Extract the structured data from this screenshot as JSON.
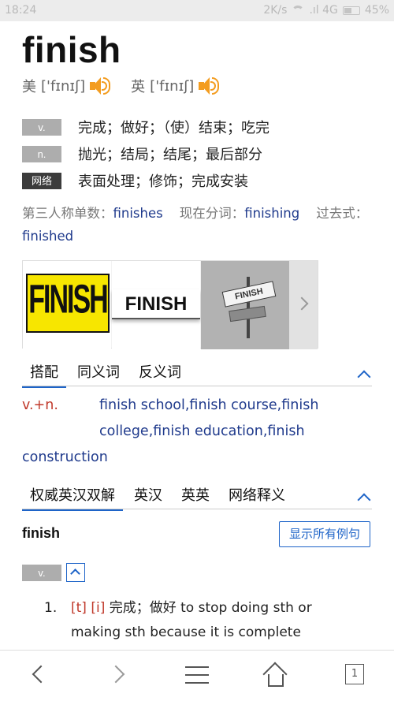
{
  "status_bar": {
    "time": "18:24",
    "network_speed": "2K/s",
    "signal": ".ıl 4G",
    "battery": "45%"
  },
  "word": "finish",
  "pronunciation": [
    {
      "label": "美",
      "ipa": "['fɪnɪʃ]"
    },
    {
      "label": "英",
      "ipa": "['fɪnɪʃ]"
    }
  ],
  "definitions": [
    {
      "pos": "v.",
      "text": "完成；做好；（使）结束；吃完"
    },
    {
      "pos": "n.",
      "text": "抛光；结局；结尾；最后部分"
    },
    {
      "pos": "网络",
      "text": "表面处理；修饰；完成安装"
    }
  ],
  "word_forms": [
    {
      "label": "第三人称单数：",
      "value": "finishes"
    },
    {
      "label": "现在分词：",
      "value": "finishing"
    },
    {
      "label": "过去式：",
      "value": "finished"
    }
  ],
  "images": {
    "thumb1_text": "FINISH",
    "thumb2_text": "FINISH",
    "thumb3_text": "FINISH"
  },
  "tabs1": [
    "搭配",
    "同义词",
    "反义词"
  ],
  "collocation": {
    "head": "v.+n.",
    "text": "finish school,finish course,finish college,finish education,finish construction",
    "line1": "finish school,finish course,finish",
    "line2": "college,finish education,finish",
    "line3": "construction"
  },
  "tabs2": [
    "权威英汉双解",
    "英汉",
    "英英",
    "网络释义"
  ],
  "dict_entry": {
    "word": "finish",
    "show_examples_label": "显示所有例句",
    "pos": "v.",
    "sense_number": "1.",
    "grammar": "[t] [i]",
    "line1_rest": "完成；做好 to stop doing sth or",
    "line2": "making sth because it is complete"
  },
  "bottom_nav": {
    "tab_count": "1"
  },
  "colors": {
    "accent": "#1e64c8",
    "link": "#1f3a8c",
    "speaker": "#f39c1f",
    "grammar": "#c0392b"
  }
}
